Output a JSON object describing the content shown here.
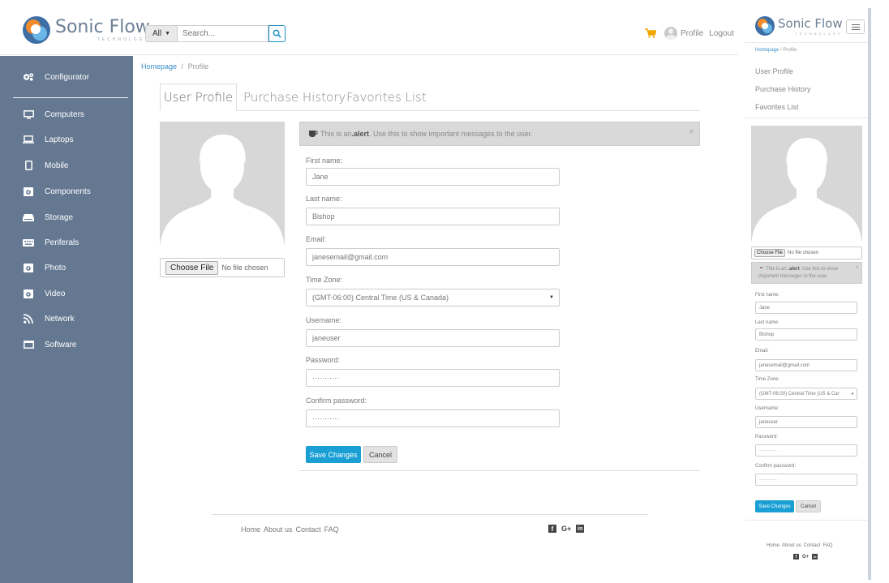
{
  "app": {
    "logo_text": "Sonic Flow",
    "logo_sub": "TECHNOLOGY"
  },
  "search": {
    "category": "All",
    "placeholder": "Search..."
  },
  "header": {
    "profile_label": "Profile",
    "logout_label": "Logout"
  },
  "sidebar": {
    "items": [
      {
        "label": "Configurator",
        "icon": "gears-icon"
      },
      {
        "label": "Computers",
        "icon": "monitor-icon"
      },
      {
        "label": "Laptops",
        "icon": "laptop-icon"
      },
      {
        "label": "Mobile",
        "icon": "mobile-icon"
      },
      {
        "label": "Components",
        "icon": "component-icon"
      },
      {
        "label": "Storage",
        "icon": "hdd-icon"
      },
      {
        "label": "Periferals",
        "icon": "keyboard-icon"
      },
      {
        "label": "Photo",
        "icon": "camera-icon"
      },
      {
        "label": "Video",
        "icon": "video-icon"
      },
      {
        "label": "Network",
        "icon": "rss-icon"
      },
      {
        "label": "Software",
        "icon": "window-icon"
      }
    ]
  },
  "breadcrumb": {
    "home": "Homepage",
    "separator": "/",
    "current": "Profile"
  },
  "tabs": [
    "User Profile",
    "Purchase History",
    "Favorites List"
  ],
  "file": {
    "button": "Choose File",
    "status": "No file chosen"
  },
  "alert": {
    "prefix": "This is an ",
    "strong": ".alert",
    "suffix": ". Use this to show important messages to the user.",
    "close": "×"
  },
  "form": {
    "first_name_label": "First name:",
    "first_name": "Jane",
    "last_name_label": "Last name:",
    "last_name": "Bishop",
    "email_label": "Email:",
    "email": "janesemail@gmail.com",
    "timezone_label": "Time Zone:",
    "timezone": "(GMT-06:00) Central Time (US & Canada)",
    "username_label": "Username:",
    "username": "janeuser",
    "password_label": "Password:",
    "password": "···········",
    "confirm_label": "Confirm password:",
    "confirm": "···········",
    "save": "Save Changes",
    "cancel": "Cancel"
  },
  "footer": {
    "links": [
      "Home",
      "About us",
      "Contact",
      "FAQ"
    ],
    "social": [
      "f",
      "G+",
      "in"
    ]
  },
  "mobile": {
    "breadcrumb_home": "Homepage",
    "breadcrumb_current": "Profile",
    "timezone_short": "(GMT-06:00) Central Time (US & Car",
    "first_name_label": "First name:",
    "last_name_label": "Last name:",
    "email_label": "Email:",
    "timezone_label": "Time Zone:",
    "username_label": "Username:",
    "password_label": "Password:",
    "confirm_label": "Confirm password:"
  },
  "colors": {
    "sidebar_bg": "#657891",
    "accent": "#1a9fd5",
    "cart": "#f0a500"
  }
}
